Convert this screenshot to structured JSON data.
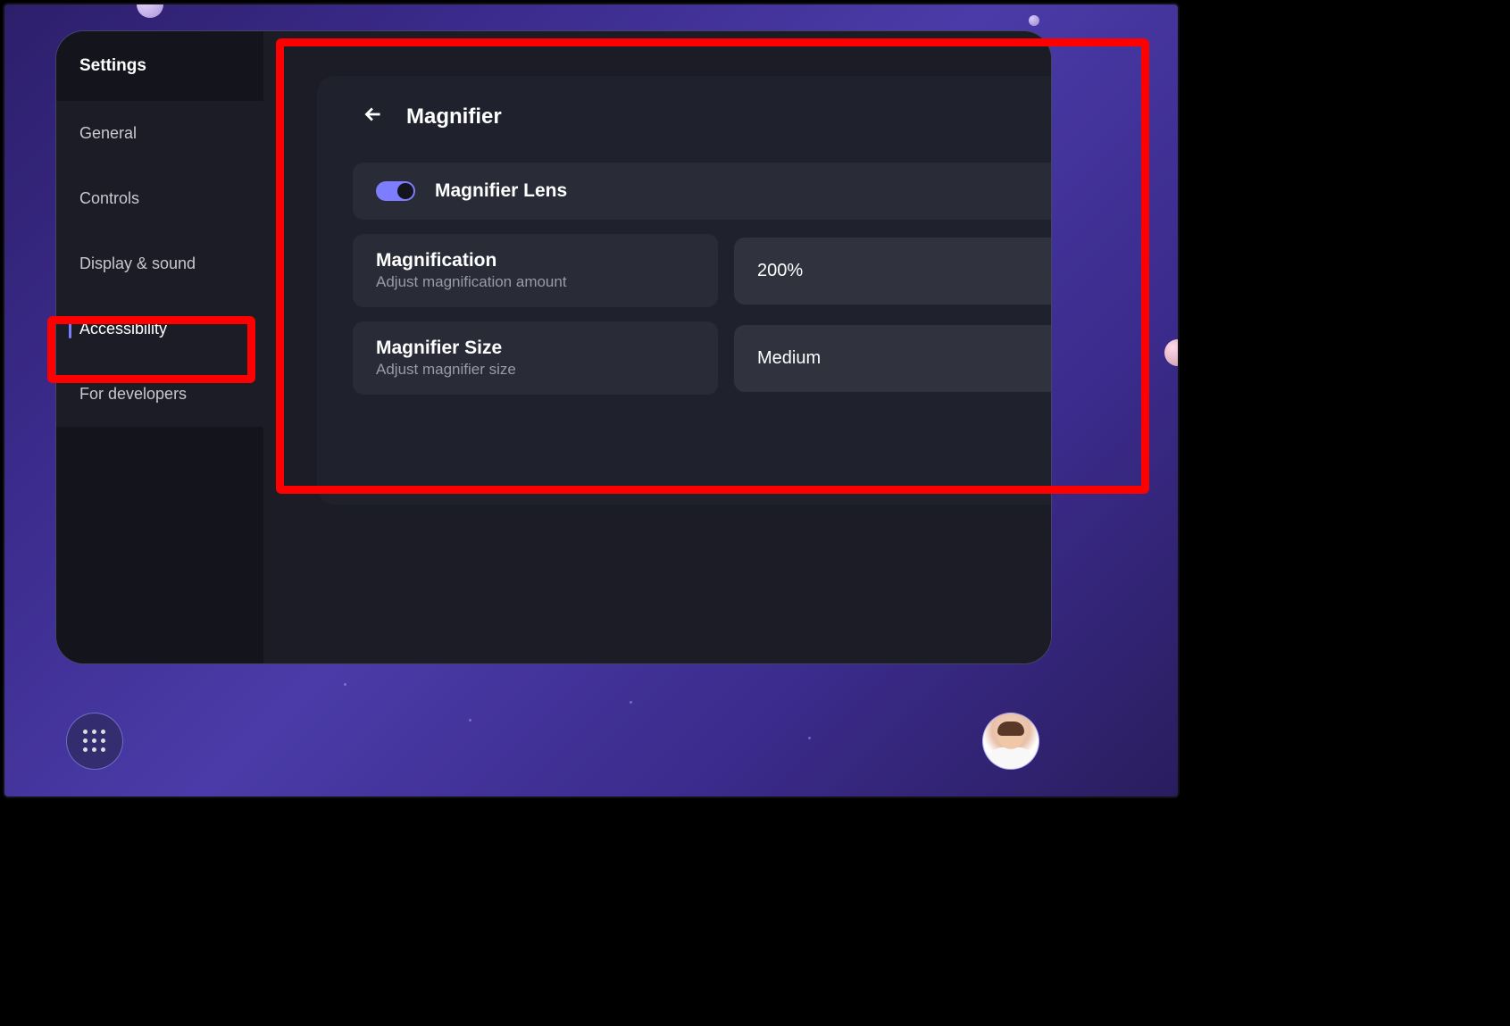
{
  "sidebar": {
    "header": "Settings",
    "items": [
      {
        "label": "General",
        "active": false
      },
      {
        "label": "Controls",
        "active": false
      },
      {
        "label": "Display & sound",
        "active": false
      },
      {
        "label": "Accessibility",
        "active": true
      },
      {
        "label": "For developers",
        "active": false
      }
    ]
  },
  "panel": {
    "title": "Magnifier",
    "toggle": {
      "label": "Magnifier Lens",
      "enabled": true
    },
    "magnification": {
      "title": "Magnification",
      "subtitle": "Adjust magnification amount",
      "value": "200%"
    },
    "size": {
      "title": "Magnifier Size",
      "subtitle": "Adjust magnifier size",
      "value": "Medium"
    }
  },
  "colors": {
    "accent": "#7d7dff",
    "highlight": "#ff0000",
    "bg_window": "#14141c",
    "bg_content": "#1c1c26"
  }
}
